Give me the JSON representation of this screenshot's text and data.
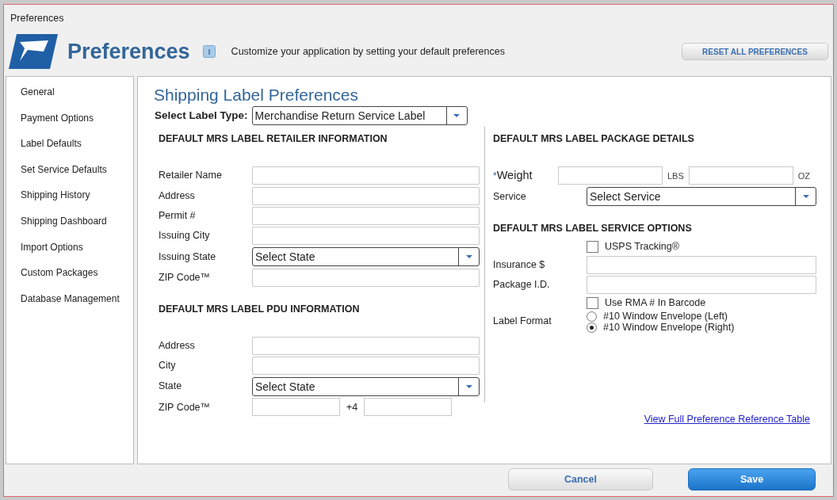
{
  "window": {
    "title": "Preferences"
  },
  "header": {
    "title": "Preferences",
    "description": "Customize your application by setting your default preferences",
    "reset_button": "RESET ALL PREFERENCES"
  },
  "sidebar": {
    "items": [
      {
        "label": "General"
      },
      {
        "label": "Payment Options"
      },
      {
        "label": "Label Defaults"
      },
      {
        "label": "Set Service Defaults"
      },
      {
        "label": "Shipping History"
      },
      {
        "label": "Shipping Dashboard"
      },
      {
        "label": "Import Options"
      },
      {
        "label": "Custom Packages"
      },
      {
        "label": "Database Management"
      }
    ]
  },
  "main": {
    "title": "Shipping Label Preferences",
    "label_type": {
      "label": "Select Label Type:",
      "value": "Merchandise Return Service Label"
    },
    "left_sections": [
      {
        "heading": "DEFAULT MRS LABEL RETAILER INFORMATION",
        "fields": [
          {
            "kind": "text",
            "label": "Retailer Name"
          },
          {
            "kind": "text",
            "label": "Address"
          },
          {
            "kind": "text",
            "label": "Permit #"
          },
          {
            "kind": "text",
            "label": "Issuing City"
          },
          {
            "kind": "select",
            "label": "Issuing State",
            "value": "Select State"
          },
          {
            "kind": "text",
            "label": "ZIP Code™"
          }
        ]
      },
      {
        "heading": "DEFAULT MRS LABEL PDU INFORMATION",
        "fields": [
          {
            "kind": "text",
            "label": "Address"
          },
          {
            "kind": "text",
            "label": "City"
          },
          {
            "kind": "select",
            "label": "State",
            "value": "Select State"
          },
          {
            "kind": "zip4",
            "label": "ZIP Code™",
            "plus": "+4"
          }
        ]
      }
    ],
    "right_sections": [
      {
        "heading": "DEFAULT MRS LABEL PACKAGE DETAILS",
        "fields": [
          {
            "kind": "weight",
            "required_mark": "*",
            "label": "Weight",
            "units": [
              "LBS",
              "OZ"
            ]
          },
          {
            "kind": "select",
            "label": "Service",
            "value": "Select Service"
          }
        ]
      },
      {
        "heading": "DEFAULT MRS LABEL SERVICE OPTIONS",
        "fields": [
          {
            "kind": "checkbox",
            "label": "USPS Tracking®",
            "checked": false
          },
          {
            "kind": "text",
            "label": "Insurance $"
          },
          {
            "kind": "text",
            "label": "Package I.D."
          },
          {
            "kind": "checkbox",
            "label": "Use RMA # In Barcode",
            "checked": false
          },
          {
            "kind": "radio",
            "label": "Label Format",
            "options": [
              {
                "label": "#10 Window Envelope (Left)",
                "selected": false
              },
              {
                "label": "#10 Window Envelope (Right)",
                "selected": true
              }
            ]
          }
        ]
      }
    ],
    "link": "View Full Preference Reference Table"
  },
  "footer": {
    "buttons": [
      {
        "kind": "secondary",
        "label": "Cancel"
      },
      {
        "kind": "primary",
        "label": "Save"
      }
    ]
  }
}
